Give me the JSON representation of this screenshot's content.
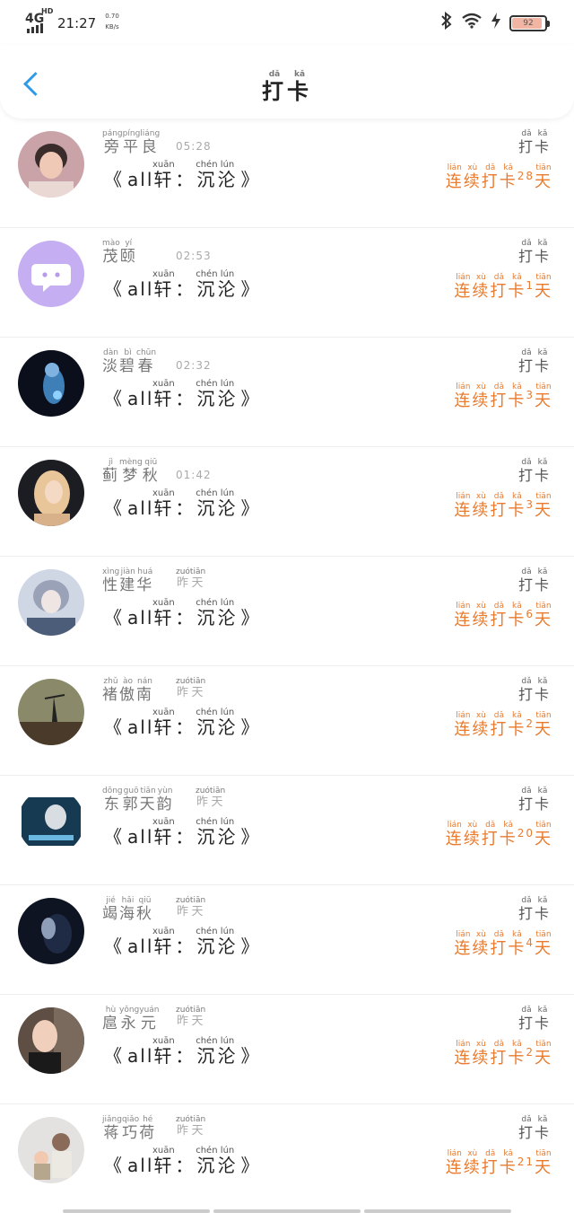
{
  "status": {
    "network": "4G",
    "network_sup": "HD",
    "time": "21:27",
    "speed_value": "0.70",
    "speed_unit": "KB/s",
    "battery": "92",
    "battery_level": 0.92,
    "icons": [
      "bluetooth-icon",
      "wifi-icon",
      "charging-icon"
    ]
  },
  "header": {
    "title_chars": [
      "打",
      "卡"
    ],
    "title_pinyin": [
      "dǎ",
      "kǎ"
    ],
    "back_icon": "chevron-left-icon",
    "accent": "#2f9be6"
  },
  "checkin_label": {
    "chars": [
      "打",
      "卡"
    ],
    "pinyin": [
      "dǎ",
      "kǎ"
    ]
  },
  "song": {
    "open": "《",
    "prefix": "all",
    "c1": "轩",
    "p1": "xuān",
    "sep": "：",
    "c2": "沉",
    "p2": "chén",
    "c3": "沦",
    "p3": "lún",
    "close": "》"
  },
  "streak_label": {
    "c": [
      "连",
      "续",
      "打",
      "卡",
      "天"
    ],
    "p": [
      "lián",
      "xù",
      "dǎ",
      "kǎ",
      "tiān"
    ],
    "color": "#e87b2f"
  },
  "yesterday": {
    "c": [
      "昨",
      "天"
    ],
    "p": [
      "zuó",
      "tiān"
    ]
  },
  "entries": [
    {
      "name_c": [
        "旁",
        "平",
        "良"
      ],
      "name_p": [
        "páng",
        "píng",
        "liáng"
      ],
      "time": "05:28",
      "days": "28"
    },
    {
      "name_c": [
        "茂",
        "颐"
      ],
      "name_p": [
        "mào",
        "yí"
      ],
      "time": "02:53",
      "days": "1"
    },
    {
      "name_c": [
        "淡",
        "碧",
        "春"
      ],
      "name_p": [
        "dàn",
        "bì",
        "chūn"
      ],
      "time": "02:32",
      "days": "3"
    },
    {
      "name_c": [
        "蓟",
        "梦",
        "秋"
      ],
      "name_p": [
        "jì",
        "mèng",
        "qiū"
      ],
      "time": "01:42",
      "days": "3"
    },
    {
      "name_c": [
        "性",
        "建",
        "华"
      ],
      "name_p": [
        "xìng",
        "jiàn",
        "huá"
      ],
      "time": "",
      "days": "6"
    },
    {
      "name_c": [
        "褚",
        "傲",
        "南"
      ],
      "name_p": [
        "zhǔ",
        "ào",
        "nán"
      ],
      "time": "",
      "days": "2"
    },
    {
      "name_c": [
        "东",
        "郭",
        "天",
        "韵"
      ],
      "name_p": [
        "dōng",
        "guō",
        "tiān",
        "yùn"
      ],
      "time": "",
      "days": "20"
    },
    {
      "name_c": [
        "竭",
        "海",
        "秋"
      ],
      "name_p": [
        "jié",
        "hǎi",
        "qiū"
      ],
      "time": "",
      "days": "4"
    },
    {
      "name_c": [
        "扈",
        "永",
        "元"
      ],
      "name_p": [
        "hù",
        "yǒng",
        "yuán"
      ],
      "time": "",
      "days": "2"
    },
    {
      "name_c": [
        "蒋",
        "巧",
        "荷"
      ],
      "name_p": [
        "jiǎng",
        "qiǎo",
        "hé"
      ],
      "time": "",
      "days": "21"
    }
  ]
}
